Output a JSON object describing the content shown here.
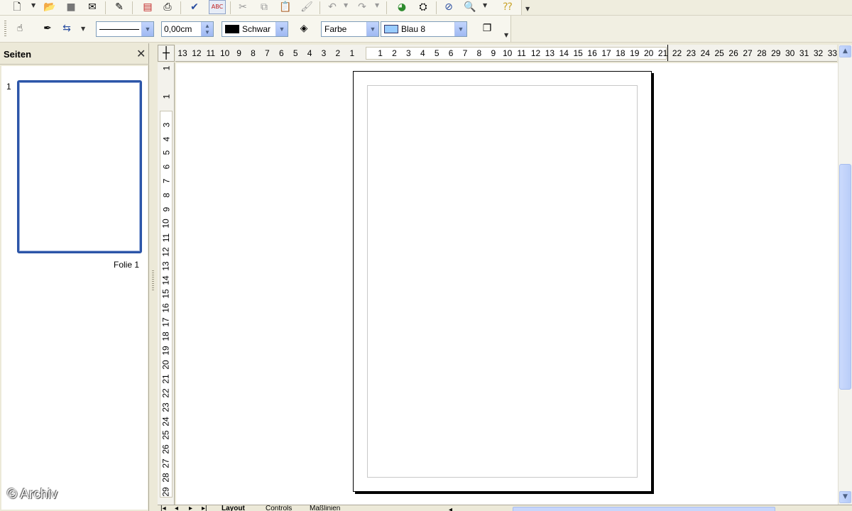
{
  "toolbar_top": {
    "icons": [
      "new-document-icon",
      "open-folder-icon",
      "save-icon",
      "email-icon",
      "edit-file-icon",
      "export-pdf-icon",
      "print-icon",
      "spellcheck-icon",
      "autospellcheck-icon",
      "cut-icon",
      "copy-icon",
      "paste-icon",
      "clone-format-icon",
      "undo-icon",
      "redo-icon",
      "chart-icon",
      "navigator-icon",
      "zoom-icon",
      "help-icon"
    ]
  },
  "toolbar_line": {
    "line_width": "0,00cm",
    "line_color": "Schwar",
    "line_color_hex": "#000000",
    "area_style": "Farbe",
    "area_color": "Blau 8",
    "area_color_hex": "#99ccff"
  },
  "sidebar": {
    "title": "Seiten",
    "slides": [
      {
        "number": "1",
        "label": "Folie 1"
      }
    ]
  },
  "hruler": {
    "ticks": [
      "13",
      "12",
      "11",
      "10",
      "9",
      "8",
      "7",
      "6",
      "5",
      "4",
      "3",
      "2",
      "1",
      "",
      "1",
      "2",
      "3",
      "4",
      "5",
      "6",
      "7",
      "8",
      "9",
      "10",
      "11",
      "12",
      "13",
      "14",
      "15",
      "16",
      "17",
      "18",
      "19",
      "20",
      "21",
      "22",
      "23",
      "24",
      "25",
      "26",
      "27",
      "28",
      "29",
      "30",
      "31",
      "32",
      "33"
    ]
  },
  "vruler": {
    "ticks": [
      "1",
      "",
      "1",
      "",
      "3",
      "4",
      "5",
      "6",
      "7",
      "8",
      "9",
      "10",
      "11",
      "12",
      "13",
      "14",
      "15",
      "16",
      "17",
      "18",
      "19",
      "20",
      "21",
      "22",
      "23",
      "24",
      "25",
      "26",
      "27",
      "28",
      "29"
    ]
  },
  "bottom_tabs": [
    "Layout",
    "Controls",
    "Maßlinien"
  ],
  "watermark": "© Archiv"
}
